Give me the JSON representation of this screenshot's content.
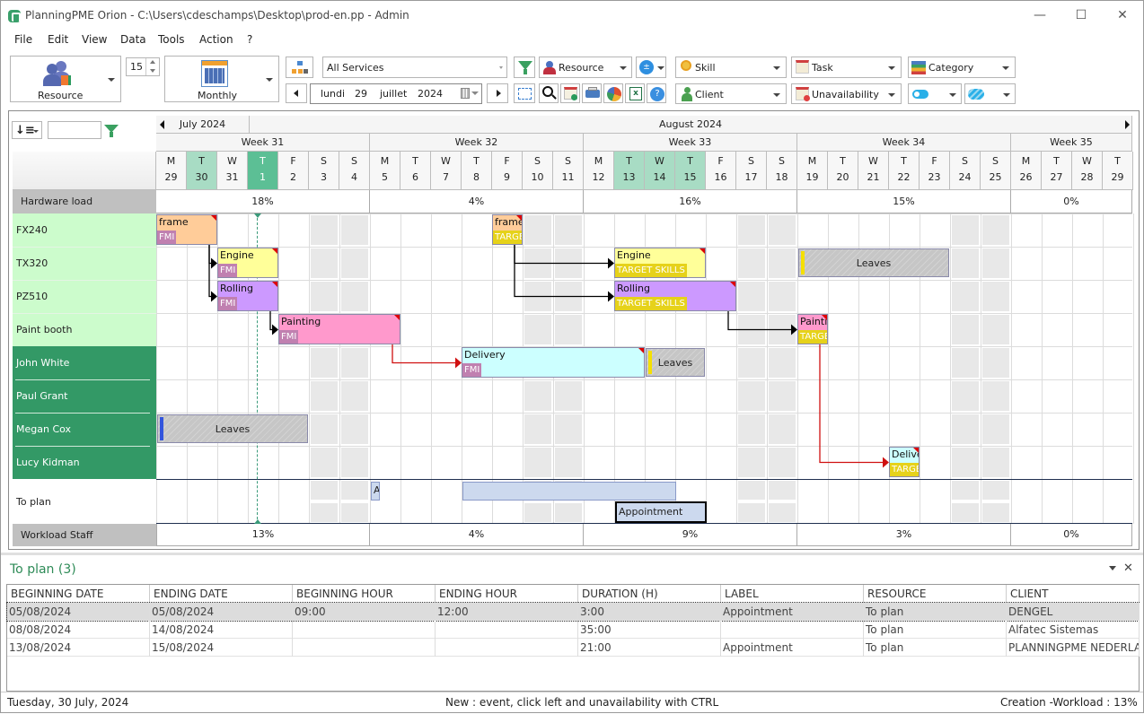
{
  "window": {
    "title": "PlanningPME Orion - C:\\Users\\cdeschamps\\Desktop\\prod-en.pp - Admin",
    "minimize": "—",
    "maximize": "☐",
    "close": "✕"
  },
  "menu": [
    "File",
    "Edit",
    "View",
    "Data",
    "Tools",
    "Action",
    "?"
  ],
  "toolbar": {
    "resource_view_label": "Resource",
    "count_value": "15",
    "period_label": "Monthly",
    "services_select": "All Services",
    "date": {
      "day_name": "lundi",
      "day": "29",
      "month": "juillet",
      "year": "2024"
    },
    "resource_filter": "Resource",
    "skill_filter": "Skill",
    "task_filter": "Task",
    "category_filter": "Category",
    "client_filter": "Client",
    "unavailability_filter": "Unavailability"
  },
  "grid": {
    "sort_input_value": "",
    "months": [
      {
        "label": "July 2024"
      },
      {
        "label": "August 2024"
      }
    ],
    "weeks": [
      "Week 31",
      "Week 32",
      "Week 33",
      "Week 34",
      "Week 35"
    ],
    "days": [
      {
        "l": "M",
        "n": "29",
        "hl": ""
      },
      {
        "l": "T",
        "n": "30",
        "hl": "light"
      },
      {
        "l": "W",
        "n": "31",
        "hl": ""
      },
      {
        "l": "T",
        "n": "1",
        "hl": "today"
      },
      {
        "l": "F",
        "n": "2",
        "hl": ""
      },
      {
        "l": "S",
        "n": "3",
        "hl": ""
      },
      {
        "l": "S",
        "n": "4",
        "hl": ""
      },
      {
        "l": "M",
        "n": "5",
        "hl": ""
      },
      {
        "l": "T",
        "n": "6",
        "hl": ""
      },
      {
        "l": "W",
        "n": "7",
        "hl": ""
      },
      {
        "l": "T",
        "n": "8",
        "hl": ""
      },
      {
        "l": "F",
        "n": "9",
        "hl": ""
      },
      {
        "l": "S",
        "n": "10",
        "hl": ""
      },
      {
        "l": "S",
        "n": "11",
        "hl": ""
      },
      {
        "l": "M",
        "n": "12",
        "hl": ""
      },
      {
        "l": "T",
        "n": "13",
        "hl": "light"
      },
      {
        "l": "W",
        "n": "14",
        "hl": "light"
      },
      {
        "l": "T",
        "n": "15",
        "hl": "light"
      },
      {
        "l": "F",
        "n": "16",
        "hl": ""
      },
      {
        "l": "S",
        "n": "17",
        "hl": ""
      },
      {
        "l": "S",
        "n": "18",
        "hl": ""
      },
      {
        "l": "M",
        "n": "19",
        "hl": ""
      },
      {
        "l": "T",
        "n": "20",
        "hl": ""
      },
      {
        "l": "W",
        "n": "21",
        "hl": ""
      },
      {
        "l": "T",
        "n": "22",
        "hl": ""
      },
      {
        "l": "F",
        "n": "23",
        "hl": ""
      },
      {
        "l": "S",
        "n": "24",
        "hl": ""
      },
      {
        "l": "S",
        "n": "25",
        "hl": ""
      },
      {
        "l": "M",
        "n": "26",
        "hl": ""
      },
      {
        "l": "T",
        "n": "27",
        "hl": ""
      },
      {
        "l": "W",
        "n": "28",
        "hl": ""
      },
      {
        "l": "T",
        "n": "29",
        "hl": ""
      }
    ],
    "hardware_load_label": "Hardware load",
    "hardware_load": [
      "18%",
      "4%",
      "16%",
      "15%",
      "0%"
    ],
    "workload_staff_label": "Workload Staff",
    "workload_staff": [
      "13%",
      "4%",
      "9%",
      "3%",
      "0%"
    ],
    "resources": [
      {
        "name": "FX240",
        "type": "hardware"
      },
      {
        "name": "TX320",
        "type": "hardware"
      },
      {
        "name": "PZ510",
        "type": "hardware"
      },
      {
        "name": "Paint booth",
        "type": "hardware"
      },
      {
        "name": "John White",
        "type": "staff"
      },
      {
        "name": "Paul Grant",
        "type": "staff"
      },
      {
        "name": "Megan Cox",
        "type": "staff"
      },
      {
        "name": "Lucy Kidman",
        "type": "staff"
      }
    ],
    "to_plan_label": "To plan",
    "tasks": [
      {
        "row": 0,
        "start": 0,
        "days": 2,
        "label": "frame",
        "sub": "FMI",
        "color": "#ffcc99",
        "subcolor": "#c080b0"
      },
      {
        "row": 1,
        "start": 2,
        "days": 2,
        "label": "Engine",
        "sub": "FMI",
        "color": "#ffff99",
        "subcolor": "#c080b0"
      },
      {
        "row": 2,
        "start": 2,
        "days": 2,
        "label": "Rolling",
        "sub": "FMI",
        "color": "#cc99ff",
        "subcolor": "#c080b0"
      },
      {
        "row": 3,
        "start": 4,
        "days": 4,
        "label": "Painting",
        "sub": "FMI",
        "color": "#ff99cc",
        "subcolor": "#c080b0"
      },
      {
        "row": 4,
        "start": 10,
        "days": 6,
        "label": "Delivery",
        "sub": "FMI",
        "color": "#ccffff",
        "subcolor": "#c080b0"
      },
      {
        "row": 0,
        "start": 11,
        "days": 1,
        "label": "frame",
        "sub": "TARGET SKILLS",
        "color": "#ffcc99",
        "subcolor": "#e6d21a"
      },
      {
        "row": 1,
        "start": 15,
        "days": 3,
        "label": "Engine",
        "sub": "TARGET SKILLS",
        "color": "#ffff99",
        "subcolor": "#e6d21a"
      },
      {
        "row": 2,
        "start": 15,
        "days": 4,
        "label": "Rolling",
        "sub": "TARGET SKILLS",
        "color": "#cc99ff",
        "subcolor": "#e6d21a"
      },
      {
        "row": 3,
        "start": 21,
        "days": 1,
        "label": "Painting",
        "sub": "TARGET SKILLS",
        "color": "#ff99cc",
        "subcolor": "#e6d21a"
      },
      {
        "row": 7,
        "start": 24,
        "days": 1,
        "label": "Delivery",
        "sub": "TARGET SKILLS",
        "color": "#ccffff",
        "subcolor": "#e6d21a"
      }
    ],
    "leaves": [
      {
        "row": 1,
        "start": 21,
        "days": 5,
        "label": "Leaves",
        "bar": "#f5e000"
      },
      {
        "row": 4,
        "start": 16,
        "days": 2,
        "label": "Leaves",
        "bar": "#f5e000"
      },
      {
        "row": 6,
        "start": 0,
        "days": 5,
        "label": "Leaves",
        "bar": "#3355dd"
      }
    ],
    "to_plan_items": [
      {
        "label": "A",
        "start": 7,
        "days": 0.3,
        "lane": 0,
        "selected": false
      },
      {
        "label": "",
        "start": 10,
        "days": 7,
        "lane": 0,
        "selected": false
      },
      {
        "label": "Appointment",
        "start": 15,
        "days": 3,
        "lane": 1,
        "selected": true
      }
    ]
  },
  "to_plan_panel": {
    "title": "To plan (3)",
    "columns": [
      "BEGINNING DATE",
      "ENDING DATE",
      "BEGINNING HOUR",
      "ENDING HOUR",
      "DURATION (H)",
      "LABEL",
      "RESOURCE",
      "CLIENT"
    ],
    "rows": [
      [
        "05/08/2024",
        "05/08/2024",
        "09:00",
        "12:00",
        "3:00",
        "Appointment",
        "To plan",
        "DENGEL"
      ],
      [
        "08/08/2024",
        "14/08/2024",
        "",
        "",
        "35:00",
        "",
        "To plan",
        "Alfatec Sistemas"
      ],
      [
        "13/08/2024",
        "15/08/2024",
        "",
        "",
        "21:00",
        "Appointment",
        "To plan",
        "PLANNINGPME NEDERLAN"
      ]
    ],
    "selected_row": 0
  },
  "status": {
    "date": "Tuesday, 30 July, 2024",
    "hint": "New : event, click left and unavailability with CTRL",
    "workload": "Creation -Workload : 13%"
  }
}
